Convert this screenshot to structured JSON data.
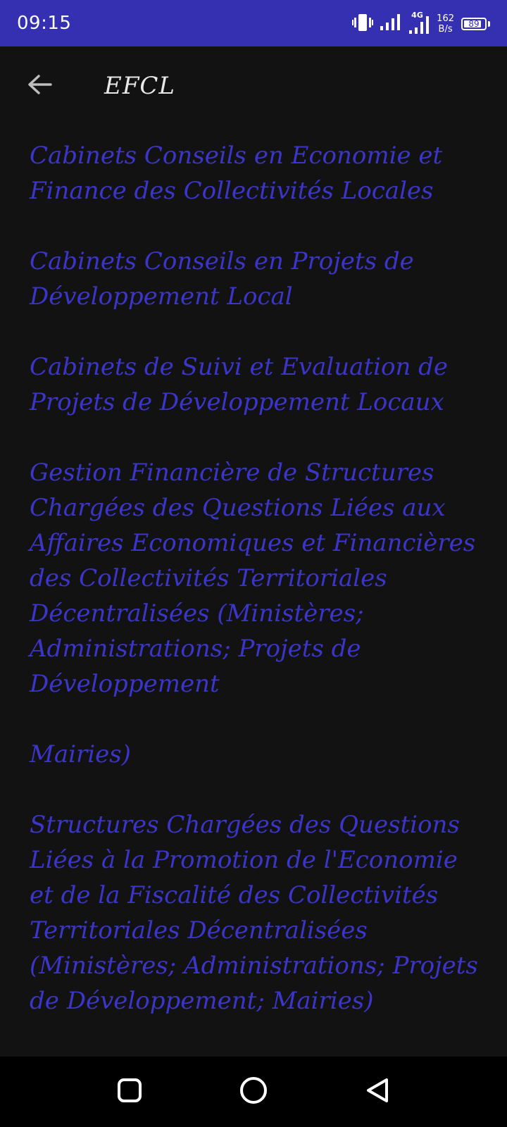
{
  "status_bar": {
    "time": "09:15",
    "network_type": "4G",
    "net_speed_value": "162",
    "net_speed_unit": "B/s",
    "battery_level": "89"
  },
  "app_bar": {
    "title": "EFCL"
  },
  "items": [
    "Cabinets Conseils en Economie et Finance des Collectivités Locales",
    "Cabinets Conseils en Projets de Développement Local",
    "Cabinets de Suivi et Evaluation de Projets de Développement Locaux",
    "Gestion Financière de Structures Chargées des Questions Liées aux Affaires Economiques et Financières des Collectivités Territoriales Décentralisées (Ministères; Administrations; Projets de Développement",
    "Mairies)",
    "Structures Chargées des Questions Liées à la Promotion de l'Economie et de la Fiscalité des Collectivités Territoriales Décentralisées (Ministères; Administrations; Projets de Développement; Mairies)"
  ],
  "colors": {
    "status_bar": "#3530b2",
    "background": "#121212",
    "item_text": "#3b35c9",
    "title_text": "#e8e8e8"
  },
  "icons": {
    "back": "arrow-back-icon",
    "vibrate": "vibrate-icon",
    "signal": "signal-icon",
    "battery": "battery-icon",
    "nav_recents": "square-icon",
    "nav_home": "circle-icon",
    "nav_back": "triangle-back-icon"
  }
}
